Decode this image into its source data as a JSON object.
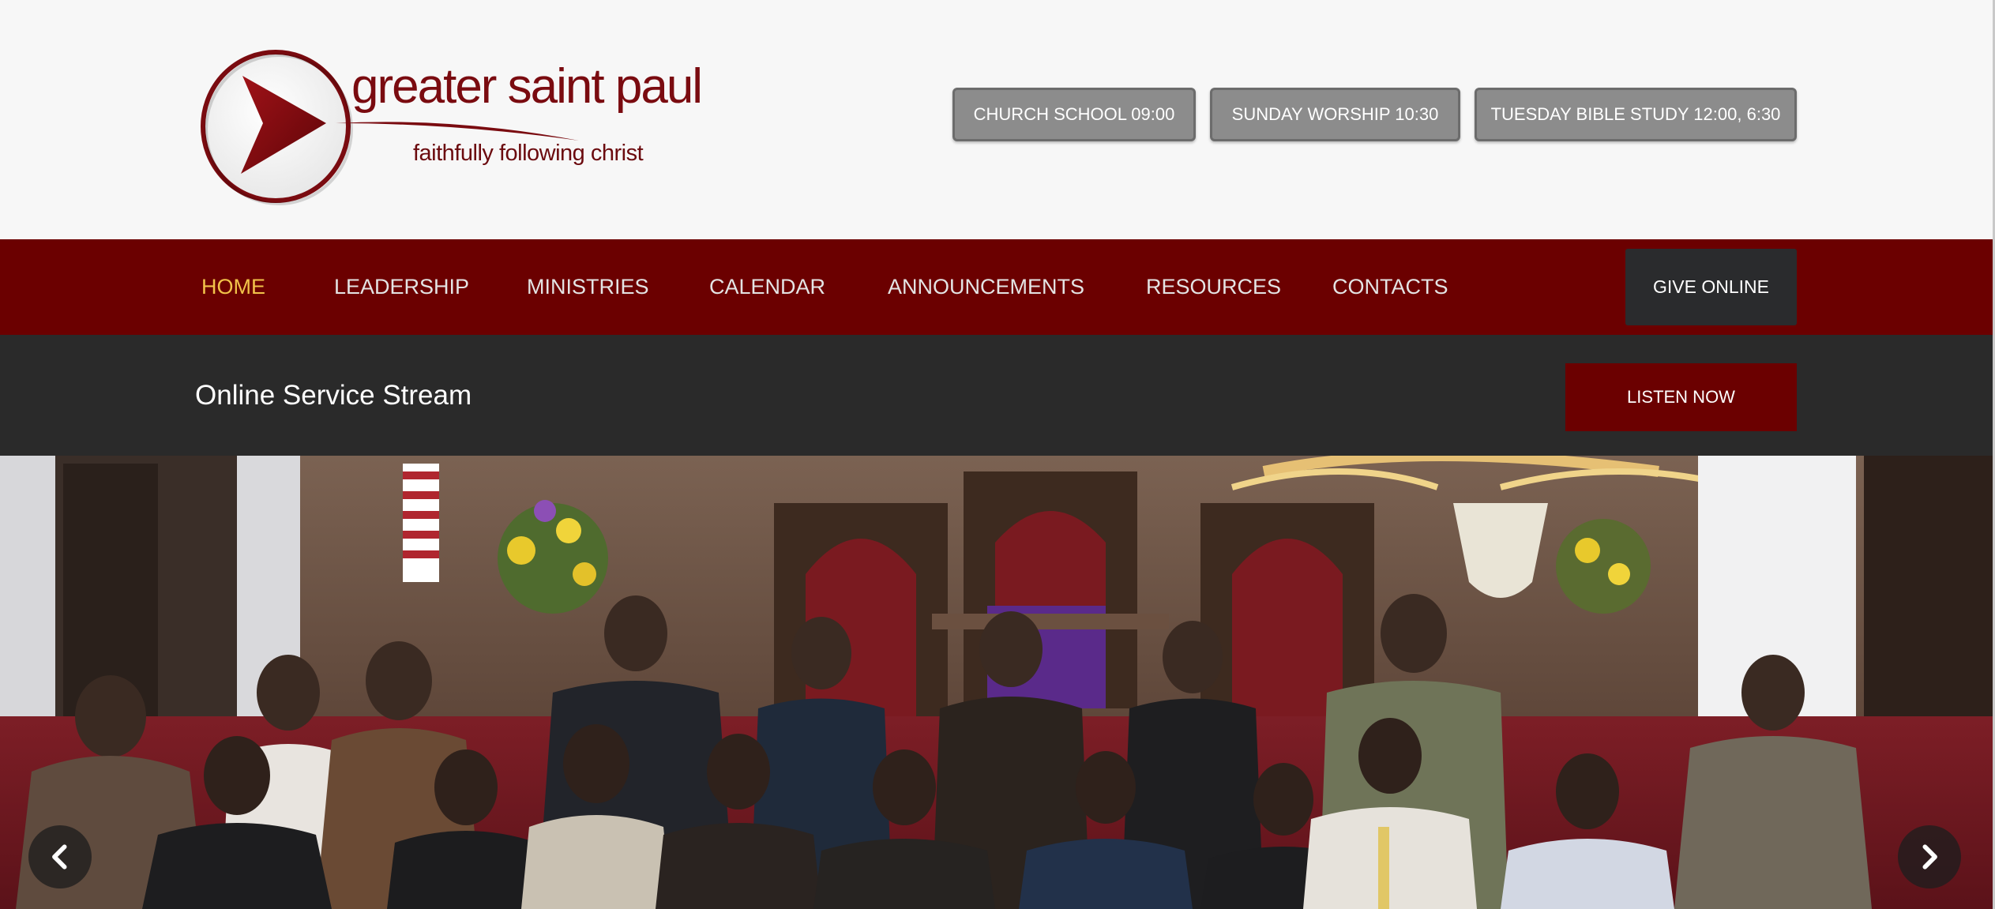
{
  "header": {
    "logo_title": "greater saint paul",
    "logo_tagline": "faithfully following christ",
    "schedule": [
      "CHURCH SCHOOL 09:00",
      "SUNDAY WORSHIP 10:30",
      "TUESDAY BIBLE STUDY 12:00, 6:30"
    ]
  },
  "nav": {
    "items": [
      {
        "label": "HOME",
        "active": true
      },
      {
        "label": "LEADERSHIP",
        "active": false
      },
      {
        "label": "MINISTRIES",
        "active": false
      },
      {
        "label": "CALENDAR",
        "active": false
      },
      {
        "label": "ANNOUNCEMENTS",
        "active": false
      },
      {
        "label": "RESOURCES",
        "active": false
      },
      {
        "label": "CONTACTS",
        "active": false
      }
    ],
    "give_label": "GIVE ONLINE"
  },
  "stream": {
    "title": "Online Service Stream",
    "button_label": "LISTEN NOW"
  },
  "hero": {
    "prev_icon": "chevron-left-icon",
    "next_icon": "chevron-right-icon"
  },
  "colors": {
    "brand_maroon": "#6b0000",
    "active_nav": "#f2c34a",
    "dark_bar": "#2a2a2a",
    "give_button": "#2a2b2d",
    "schedule_button": "#8c8c8c"
  }
}
